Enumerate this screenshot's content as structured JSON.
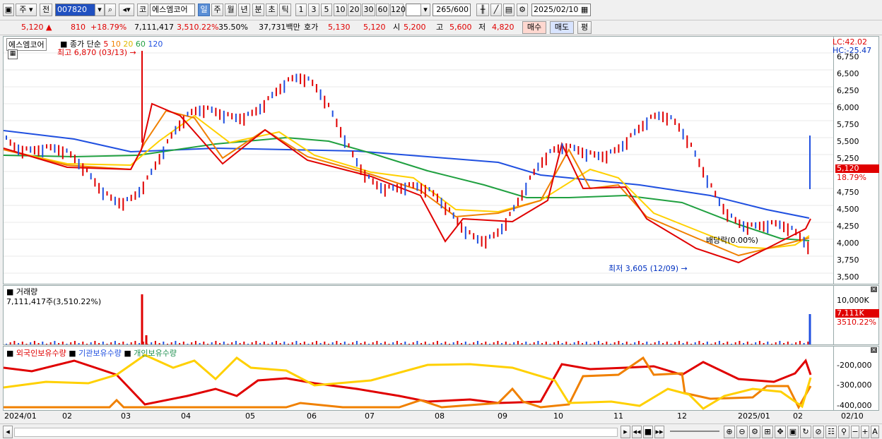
{
  "toolbar": {
    "market": "주",
    "prev_label": "전",
    "code": "007820",
    "name_prefix": "코",
    "stock_name": "에스엠코어",
    "periods": [
      "일",
      "주",
      "월",
      "년",
      "분",
      "초",
      "틱"
    ],
    "selected_period": "일",
    "intervals": [
      "1",
      "3",
      "5",
      "10",
      "20",
      "30",
      "60",
      "120"
    ],
    "count": "265",
    "count_total": "/600",
    "date": "2025/02/10"
  },
  "info": {
    "price": "5,120",
    "change": "810",
    "change_pct": "+18.79%",
    "volume": "7,111,417",
    "volume_pct": "3,510.22%",
    "turnover_pct": "35.50%",
    "amount": "37,731백만",
    "ask_label": "호가",
    "ask": "5,130",
    "bid": "5,120",
    "open_label": "시",
    "open": "5,200",
    "high_label": "고",
    "high": "5,600",
    "low_label": "저",
    "low": "4,820",
    "buy_label": "매수",
    "sell_label": "매도",
    "eval_label": "평"
  },
  "price_pane": {
    "name_tag": "에스엠코어",
    "legend_label": "종가 단순",
    "ma_periods": [
      "5",
      "10",
      "20",
      "60",
      "120"
    ],
    "ma_colors": [
      "#e00000",
      "#f08000",
      "#ffd000",
      "#20a040",
      "#2050e0"
    ],
    "high_marker": "최고 6,870 (03/13)",
    "low_marker": "최저 3,605 (12/09)",
    "dividend_note": "배당락(0.00%)",
    "lc": "LC:42.02",
    "hc": "HC:-25.47",
    "ticks": [
      "6,750",
      "6,500",
      "6,250",
      "6,000",
      "5,750",
      "5,500",
      "5,250",
      "4,750",
      "4,500",
      "4,250",
      "4,000",
      "3,750",
      "3,500"
    ],
    "last_price_tag": "5,120",
    "last_pct": "18.79%"
  },
  "volume_pane": {
    "title": "거래량",
    "value": "7,111,417주(3,510.22%)",
    "tick": "10,000K",
    "last_tag": "7,111K",
    "last_pct": "3510.22%"
  },
  "holdings_pane": {
    "series": [
      "외국인보유수량",
      "기관보유수량",
      "개인보유수량"
    ],
    "colors": [
      "#e00000",
      "#2050e0",
      "#209050"
    ],
    "ticks": [
      "-200,000",
      "-300,000",
      "-400,000"
    ]
  },
  "x_axis": [
    "2024/01",
    "02",
    "03",
    "04",
    "05",
    "06",
    "07",
    "08",
    "09",
    "10",
    "11",
    "12",
    "2025/01",
    "02",
    "02/10"
  ]
}
